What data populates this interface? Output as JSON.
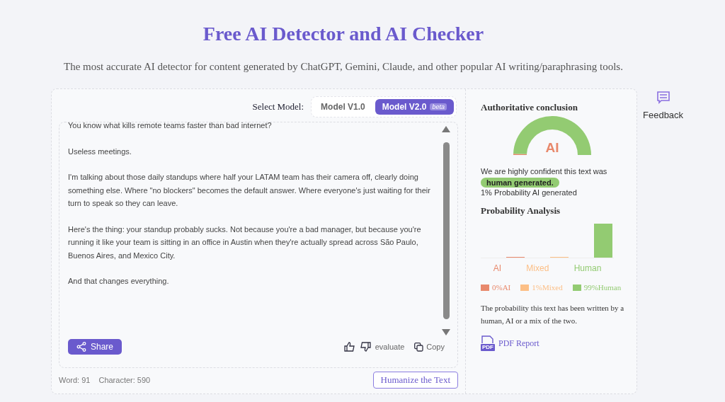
{
  "title": "Free AI Detector and AI Checker",
  "subtitle": "The most accurate AI detector for content generated by ChatGPT, Gemini, Claude, and other popular AI writing/paraphrasing tools.",
  "model_select": {
    "label": "Select Model:",
    "options": [
      {
        "label": "Model V1.0",
        "selected": false
      },
      {
        "label": "Model V2.0",
        "badge": "beta",
        "selected": true
      }
    ]
  },
  "text_paragraphs": [
    "You know what kills remote teams faster than bad internet?",
    "Useless meetings.",
    "I'm talking about those daily standups where half your LATAM team has their camera off, clearly doing something else. Where \"no blockers\" becomes the default answer. Where everyone's just waiting for their turn to speak so they can leave.",
    "Here's the thing: your standup probably sucks. Not because you're a bad manager, but because you're running it like your team is sitting in an office in Austin when they're actually spread across São Paulo, Buenos Aires, and Mexico City.",
    "And that changes everything."
  ],
  "share_button": "Share",
  "evaluate_label": "evaluate",
  "copy_button": "Copy",
  "word_count": "Word: 91",
  "character_count": "Character: 590",
  "humanize_button": "Humanize the Text",
  "conclusion": {
    "heading": "Authoritative conclusion",
    "gauge_label": "AI",
    "statement": "We are highly confident this text was",
    "verdict": "human generated.",
    "probability": "1% Probability AI generated"
  },
  "analysis": {
    "heading": "Probability Analysis",
    "chart_labels": [
      "AI",
      "Mixed",
      "Human"
    ],
    "legend": [
      {
        "label": "0%AI",
        "color": "#e8896c"
      },
      {
        "label": "1%Mixed",
        "color": "#fcbf86"
      },
      {
        "label": "99%Human",
        "color": "#93cb72"
      }
    ],
    "description": "The probability this text has been written by a human, AI or a mix of the two.",
    "pdf_icon_label": "PDF",
    "pdf_link": "PDF Report"
  },
  "feedback": "Feedback"
}
